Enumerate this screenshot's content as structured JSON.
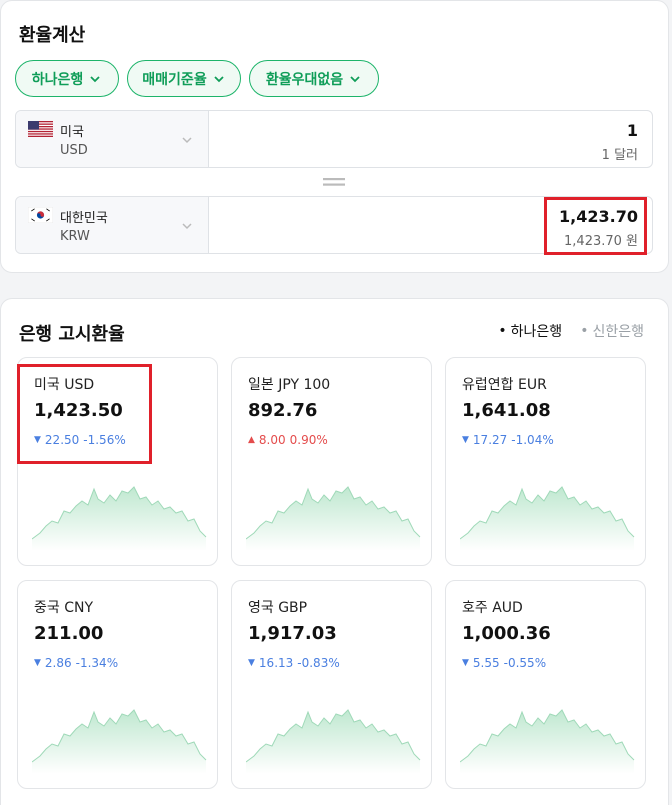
{
  "calculator": {
    "title": "환율계산",
    "chips": [
      {
        "label": "하나은행"
      },
      {
        "label": "매매기준율"
      },
      {
        "label": "환율우대없음"
      }
    ],
    "from": {
      "country": "미국",
      "code": "USD",
      "amount": "1",
      "amount_text": "1 달러",
      "flag": "us-flag"
    },
    "to": {
      "country": "대한민국",
      "code": "KRW",
      "amount": "1,423.70",
      "amount_text": "1,423.70 원",
      "flag": "kr-flag"
    }
  },
  "rates": {
    "title": "은행 고시환율",
    "banks": [
      {
        "label": "하나은행",
        "active": true
      },
      {
        "label": "신한은행",
        "active": false
      }
    ],
    "cards": [
      {
        "name": "미국 USD",
        "value": "1,423.50",
        "direction": "down",
        "change": "22.50",
        "percent": "-1.56%"
      },
      {
        "name": "일본 JPY 100",
        "value": "892.76",
        "direction": "up",
        "change": "8.00",
        "percent": "0.90%"
      },
      {
        "name": "유럽연합 EUR",
        "value": "1,641.08",
        "direction": "down",
        "change": "17.27",
        "percent": "-1.04%"
      },
      {
        "name": "중국 CNY",
        "value": "211.00",
        "direction": "down",
        "change": "2.86",
        "percent": "-1.34%"
      },
      {
        "name": "영국 GBP",
        "value": "1,917.03",
        "direction": "down",
        "change": "16.13",
        "percent": "-0.83%"
      },
      {
        "name": "호주 AUD",
        "value": "1,000.36",
        "direction": "down",
        "change": "5.55",
        "percent": "-0.55%"
      }
    ]
  },
  "colors": {
    "accent_green": "#1db46a",
    "down_blue": "#4a7fe0",
    "up_red": "#e44c4c",
    "highlight_red": "#e0202a"
  }
}
